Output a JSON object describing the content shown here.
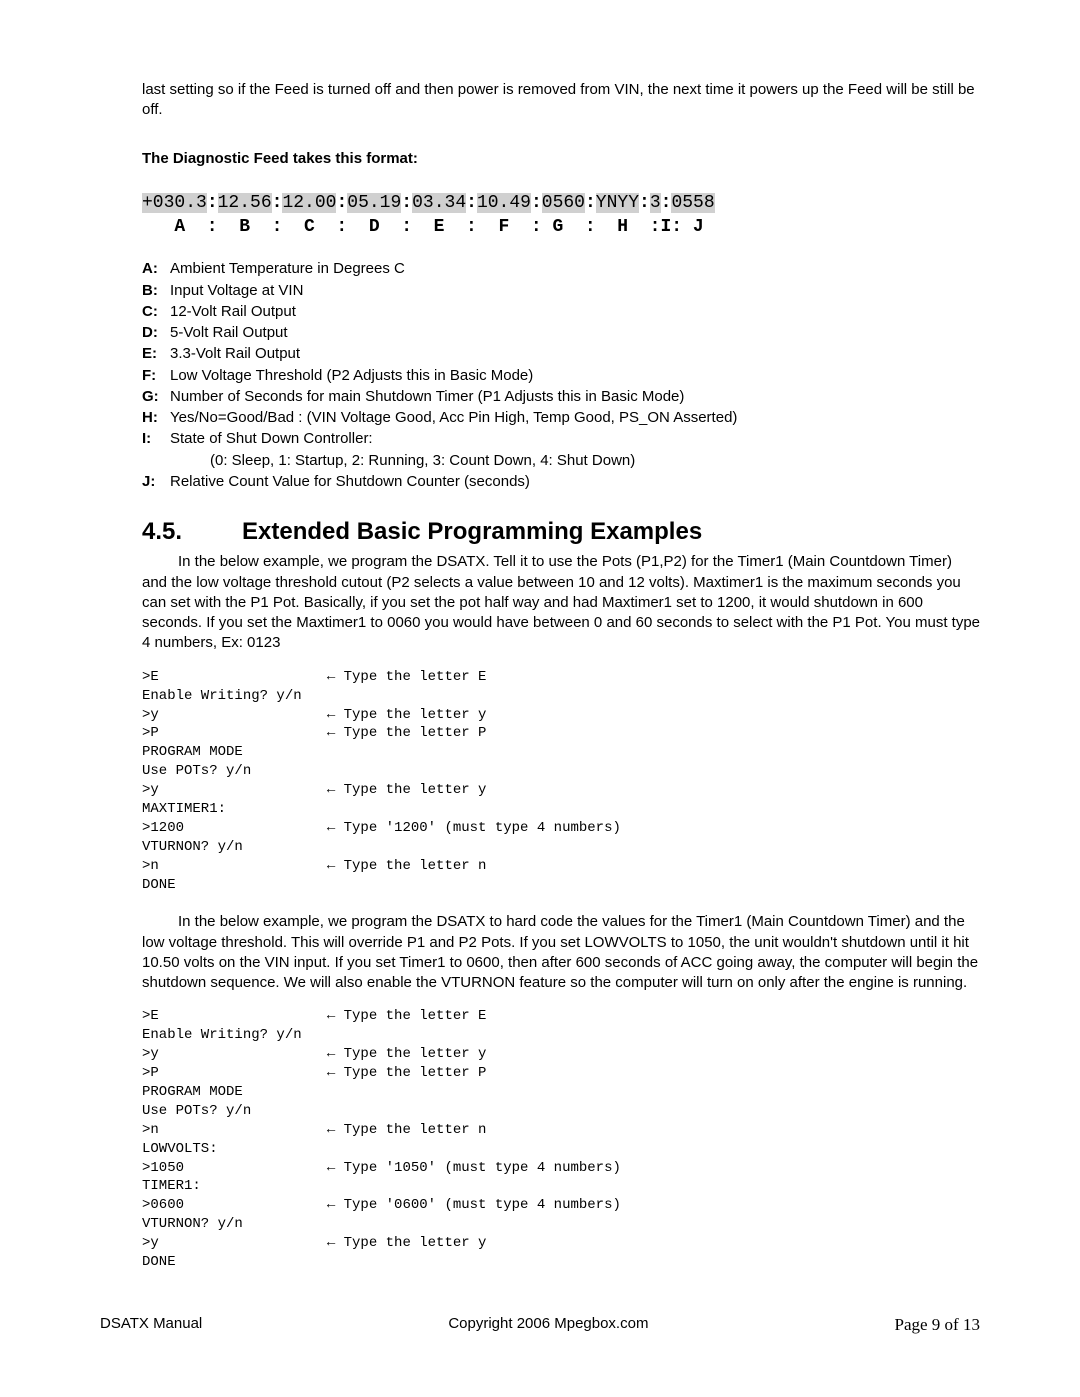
{
  "intro": "last setting so if the Feed is turned off and then power is removed from VIN, the next time it powers up the Feed will be still be off.",
  "feed_title": "The Diagnostic Feed takes this format:",
  "feed": {
    "F0": "+030.3",
    "F1": "12.56",
    "F2": "12.00",
    "F3": "05.19",
    "F4": "03.34",
    "F5": "10.49",
    "F6": "0560",
    "F7": "YNYY",
    "F8": "3",
    "F9": "0558",
    "legend": "   A  :  B  :  C  :  D  :  E  :  F  : G  :  H  :I: J"
  },
  "defs": [
    {
      "k": "A:",
      "v": "Ambient Temperature in Degrees C"
    },
    {
      "k": "B:",
      "v": "Input Voltage at VIN"
    },
    {
      "k": "C:",
      "v": "12-Volt Rail Output"
    },
    {
      "k": "D:",
      "v": "5-Volt Rail Output"
    },
    {
      "k": "E:",
      "v": "3.3-Volt Rail Output"
    },
    {
      "k": "F:",
      "v": "Low Voltage Threshold (P2 Adjusts this in Basic Mode)"
    },
    {
      "k": "G:",
      "v": "Number of Seconds for main Shutdown Timer (P1 Adjusts this in Basic Mode)"
    },
    {
      "k": "H:",
      "v": "Yes/No=Good/Bad : (VIN Voltage Good, Acc Pin High, Temp Good, PS_ON Asserted)"
    },
    {
      "k": "I:",
      "v": "State of Shut Down Controller:"
    },
    {
      "k": "",
      "v": "(0: Sleep, 1: Startup, 2: Running, 3: Count Down, 4: Shut Down)",
      "indent": true
    },
    {
      "k": "J:",
      "v": "Relative Count Value for Shutdown Counter (seconds)"
    }
  ],
  "section": {
    "num": "4.5.",
    "title": "Extended Basic Programming Examples"
  },
  "para1": "In the below example, we program the DSATX. Tell it to use the Pots (P1,P2) for the Timer1 (Main Countdown Timer) and the low voltage threshold cutout (P2 selects a value between 10 and 12 volts). Maxtimer1 is the maximum seconds you can set with the P1 Pot. Basically, if you set the pot half way and had Maxtimer1 set to 1200, it would shutdown in 600 seconds. If you set the Maxtimer1 to 0060 you would have between 0 and 60 seconds to select with the P1 Pot. You must type 4 numbers, Ex: 0123",
  "term1": ">E                    ← Type the letter E\nEnable Writing? y/n\n>y                    ← Type the letter y\n>P                    ← Type the letter P\nPROGRAM MODE\nUse POTs? y/n\n>y                    ← Type the letter y\nMAXTIMER1:\n>1200                 ← Type '1200' (must type 4 numbers)\nVTURNON? y/n\n>n                    ← Type the letter n\nDONE",
  "para2": "In the below example, we program the DSATX to hard code the values for the Timer1 (Main Countdown Timer) and the low voltage threshold. This will override P1 and P2 Pots. If you set LOWVOLTS to 1050, the unit wouldn't shutdown until it hit 10.50 volts on the VIN input. If you set Timer1 to 0600, then after 600 seconds of ACC going away, the computer will begin the shutdown sequence. We will also enable the VTURNON feature so the computer will turn on only after the engine is running.",
  "term2": ">E                    ← Type the letter E\nEnable Writing? y/n\n>y                    ← Type the letter y\n>P                    ← Type the letter P\nPROGRAM MODE\nUse POTs? y/n\n>n                    ← Type the letter n\nLOWVOLTS:\n>1050                 ← Type '1050' (must type 4 numbers)\nTIMER1:\n>0600                 ← Type '0600' (must type 4 numbers)\nVTURNON? y/n\n>y                    ← Type the letter y\nDONE",
  "footer": {
    "left": "DSATX Manual",
    "center": "Copyright 2006 Mpegbox.com",
    "right": "Page 9 of 13"
  }
}
